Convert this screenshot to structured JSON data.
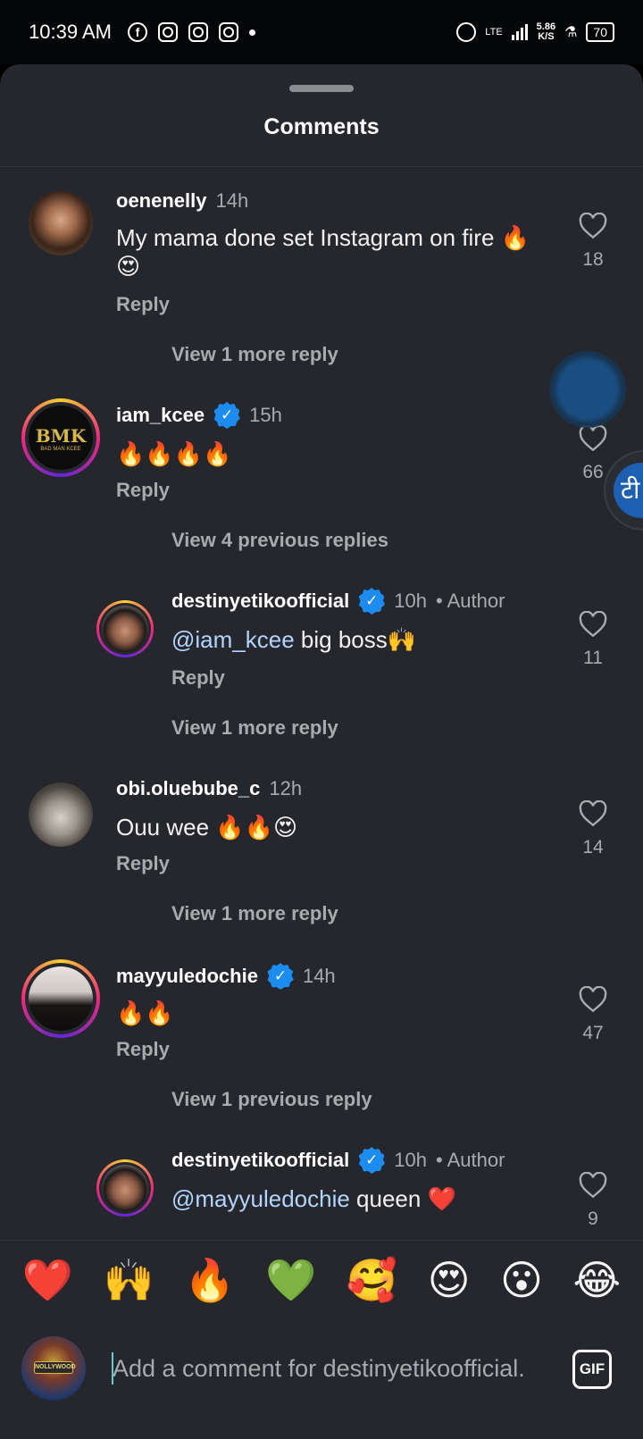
{
  "status_bar": {
    "time": "10:39 AM",
    "network": "LTE",
    "speed_value": "5.86",
    "speed_unit": "K/S",
    "battery": "70"
  },
  "sheet": {
    "title": "Comments"
  },
  "comments": [
    {
      "username": "oenenelly",
      "time": "14h",
      "verified": false,
      "text": "My mama done set Instagram on fire 🔥😍",
      "reply_label": "Reply",
      "likes": "18",
      "view_more": "View 1 more reply"
    },
    {
      "username": "iam_kcee",
      "time": "15h",
      "verified": true,
      "text": "🔥🔥🔥🔥",
      "reply_label": "Reply",
      "likes": "66",
      "view_more": "View 4 previous replies",
      "avatar_text": "BMK",
      "avatar_subtext": "BAD MAN KCEE"
    },
    {
      "username": "destinyetikoofficial",
      "time": "10h",
      "verified": true,
      "author_label": "Author",
      "mention": "@iam_kcee",
      "text": " big boss🙌",
      "reply_label": "Reply",
      "likes": "11",
      "view_more": "View 1 more reply"
    },
    {
      "username": "obi.oluebube_c",
      "time": "12h",
      "verified": false,
      "text": "Ouu wee 🔥🔥😍",
      "reply_label": "Reply",
      "likes": "14",
      "view_more": "View 1 more reply"
    },
    {
      "username": "mayyuledochie",
      "time": "14h",
      "verified": true,
      "text": "🔥🔥",
      "reply_label": "Reply",
      "likes": "47",
      "view_more": "View 1 previous reply"
    },
    {
      "username": "destinyetikoofficial",
      "time": "10h",
      "verified": true,
      "author_label": "Author",
      "mention": "@mayyuledochie",
      "text": " queen ❤️",
      "likes": "9"
    }
  ],
  "emoji_bar": [
    "❤️",
    "🙌",
    "🔥",
    "💚",
    "🥰",
    "😍",
    "😮",
    "😂"
  ],
  "composer": {
    "placeholder": "Add a comment for destinyetikoofficial.",
    "gif_label": "GIF",
    "avatar_text": "NOLLYWOOD"
  },
  "floating_tab_label": "टी",
  "colors": {
    "sheet_bg": "#25272c",
    "status_bg": "#050607",
    "verified": "#1c8cf0",
    "mention": "#b3d4ff",
    "muted_text": "#a8aaae"
  }
}
